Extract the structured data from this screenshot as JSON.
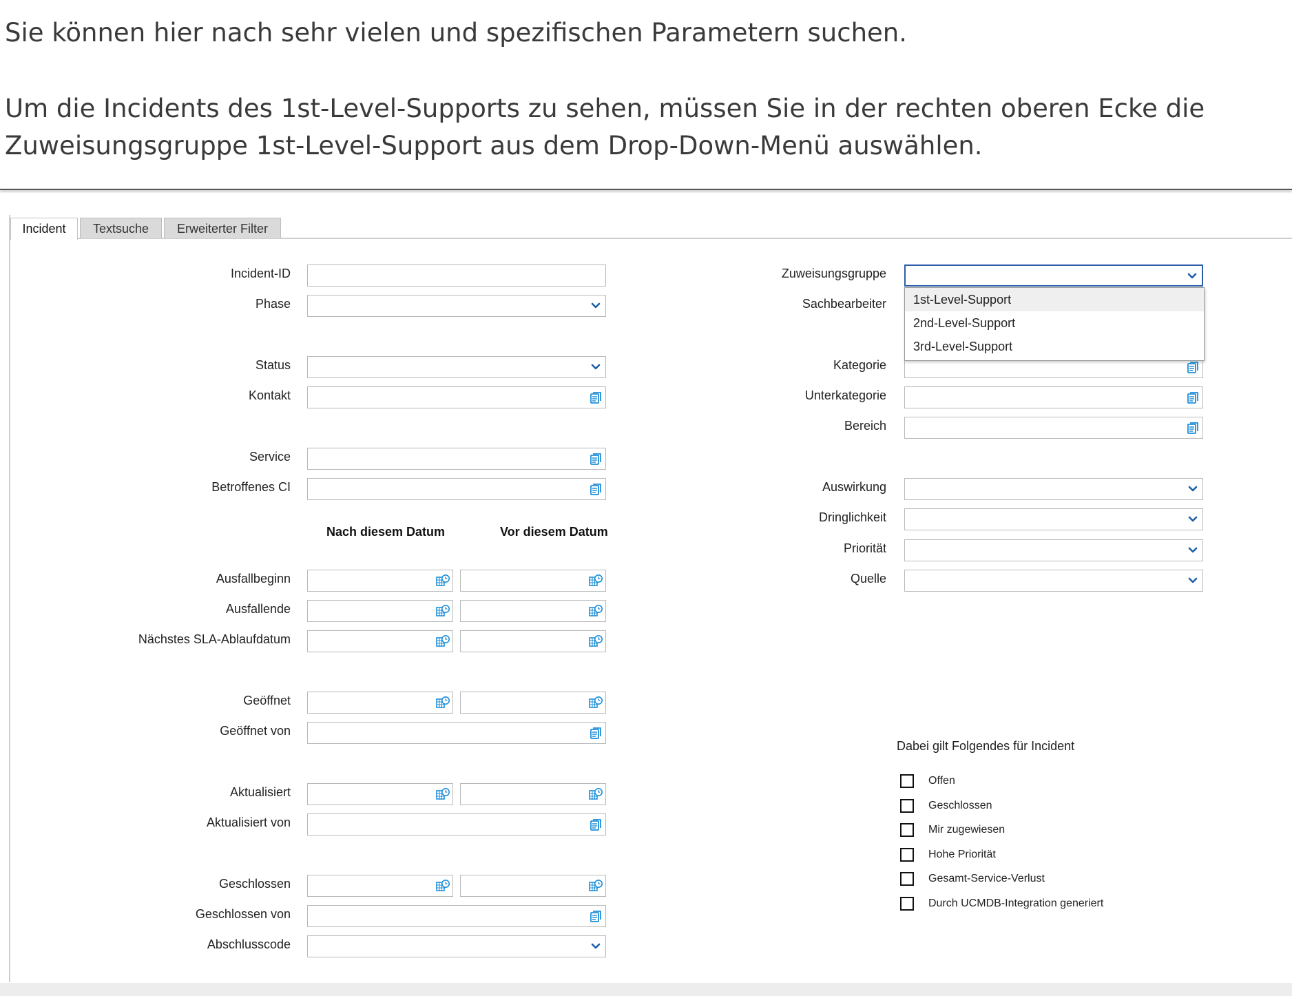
{
  "intro": {
    "line1": "Sie können hier nach sehr vielen und spezifischen Parametern suchen.",
    "line2": "Um die Incidents des 1st-Level-Supports zu sehen, müssen Sie in der rechten oberen Ecke die",
    "line3": "Zuweisungsgruppe 1st-Level-Support aus dem Drop-Down-Menü auswählen."
  },
  "tabs": [
    {
      "label": "Incident",
      "active": true
    },
    {
      "label": "Textsuche",
      "active": false
    },
    {
      "label": "Erweiterter Filter",
      "active": false
    }
  ],
  "left_fields": [
    {
      "label": "Incident-ID",
      "value": "",
      "control": "text"
    },
    {
      "label": "Phase",
      "value": "",
      "control": "select"
    },
    {
      "label": "Status",
      "value": "",
      "control": "select"
    },
    {
      "label": "Kontakt",
      "value": "",
      "control": "lookup"
    },
    {
      "label": "Service",
      "value": "",
      "control": "lookup"
    },
    {
      "label": "Betroffenes CI",
      "value": "",
      "control": "lookup"
    }
  ],
  "date_columns": {
    "after": "Nach diesem Datum",
    "before": "Vor diesem Datum"
  },
  "date_fields": [
    {
      "label": "Ausfallbeginn"
    },
    {
      "label": "Ausfallende"
    },
    {
      "label": "Nächstes SLA-Ablaufdatum"
    },
    {
      "label": "Geöffnet"
    },
    {
      "label": "Aktualisiert"
    },
    {
      "label": "Geschlossen"
    }
  ],
  "by_fields": [
    {
      "label": "Geöffnet von",
      "value": "",
      "control": "lookup"
    },
    {
      "label": "Aktualisiert von",
      "value": "",
      "control": "lookup"
    },
    {
      "label": "Geschlossen von",
      "value": "",
      "control": "lookup"
    },
    {
      "label": "Abschlusscode",
      "value": "",
      "control": "select"
    }
  ],
  "right_fields": [
    {
      "label": "Zuweisungsgruppe",
      "value": "",
      "control": "select",
      "open": true
    },
    {
      "label": "Sachbearbeiter",
      "value": "",
      "control": "lookup"
    },
    {
      "label": "Kategorie",
      "value": "",
      "control": "lookup"
    },
    {
      "label": "Unterkategorie",
      "value": "",
      "control": "lookup"
    },
    {
      "label": "Bereich",
      "value": "",
      "control": "lookup"
    },
    {
      "label": "Auswirkung",
      "value": "",
      "control": "select"
    },
    {
      "label": "Dringlichkeit",
      "value": "",
      "control": "select"
    },
    {
      "label": "Priorität",
      "value": "",
      "control": "select"
    },
    {
      "label": "Quelle",
      "value": "",
      "control": "select"
    }
  ],
  "dropdown_options": [
    "1st-Level-Support",
    "2nd-Level-Support",
    "3rd-Level-Support"
  ],
  "checkbox_title": "Dabei gilt Folgendes für Incident",
  "checkboxes": [
    {
      "label": "Offen",
      "checked": false
    },
    {
      "label": "Geschlossen",
      "checked": false
    },
    {
      "label": "Mir zugewiesen",
      "checked": false
    },
    {
      "label": "Hohe Priorität",
      "checked": false
    },
    {
      "label": "Gesamt-Service-Verlust",
      "checked": false
    },
    {
      "label": "Durch UCMDB-Integration generiert",
      "checked": false
    }
  ],
  "icons": {
    "select": "chevron-down-icon",
    "lookup": "lookup-list-icon",
    "date": "calendar-clock-icon"
  },
  "colors": {
    "icon_blue": "#1f8fd8",
    "chevron_blue": "#1b5fa8",
    "active_border": "#2b5fa8"
  }
}
